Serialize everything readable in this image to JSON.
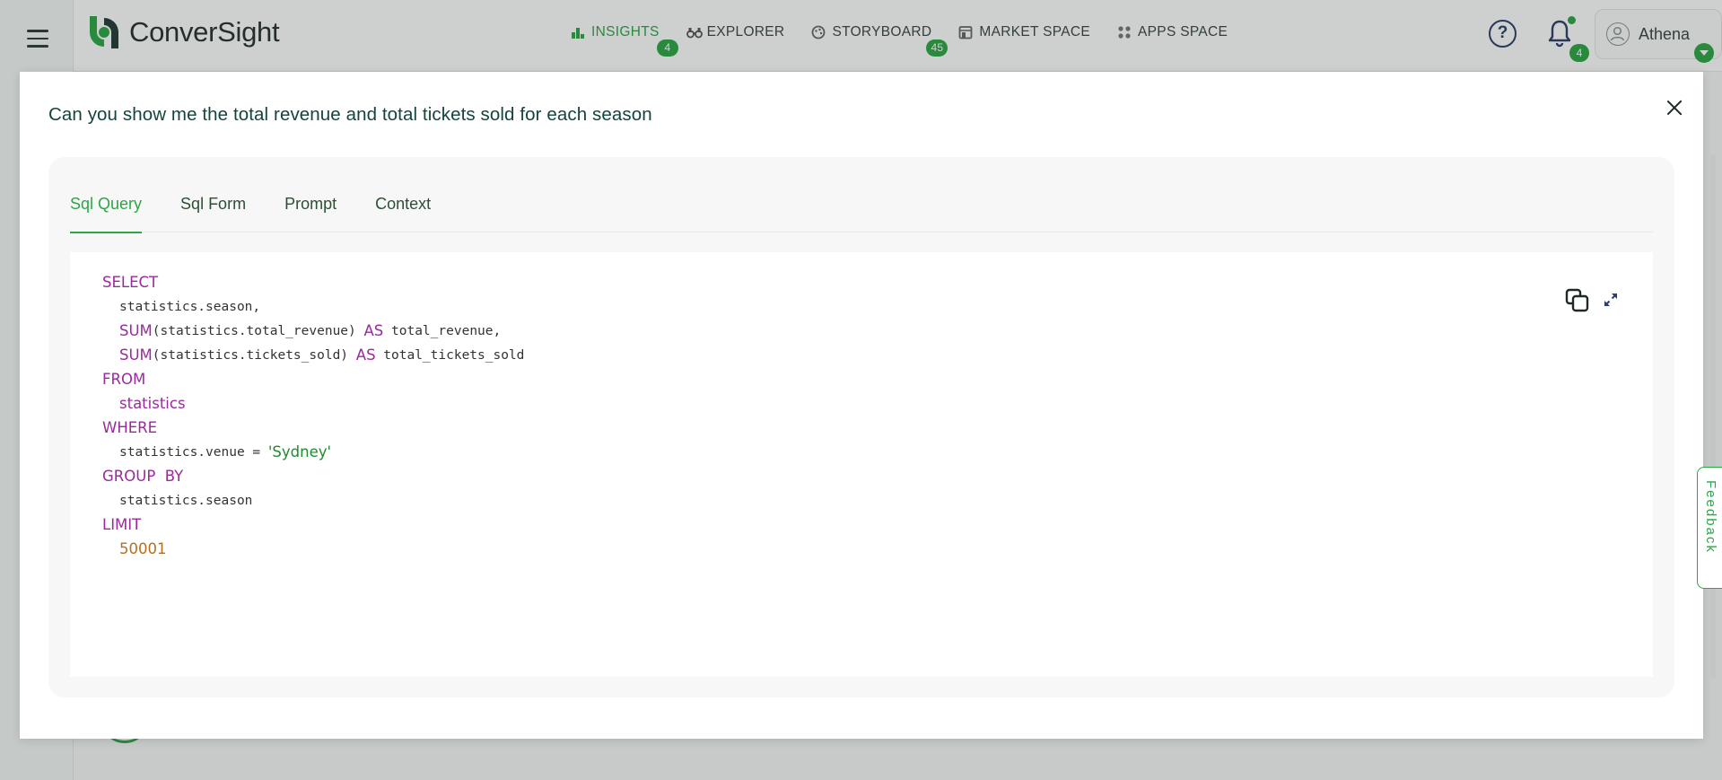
{
  "app": {
    "brand": "ConverSight",
    "nav": [
      {
        "label": "INSIGHTS",
        "badge": "4",
        "active": true,
        "icon": "bar-chart-icon"
      },
      {
        "label": "EXPLORER",
        "badge": "",
        "active": false,
        "icon": "binoculars-icon"
      },
      {
        "label": "STORYBOARD",
        "badge": "45",
        "active": false,
        "icon": "palette-icon"
      },
      {
        "label": "MARKET SPACE",
        "badge": "",
        "active": false,
        "icon": "store-icon"
      },
      {
        "label": "APPS SPACE",
        "badge": "",
        "active": false,
        "icon": "grid-icon"
      }
    ],
    "help_symbol": "?",
    "notifications_count": "4",
    "user_name": "Athena"
  },
  "modal": {
    "title": "Can you show me the total revenue and total tickets sold for each season",
    "tabs": [
      {
        "label": "Sql Query",
        "active": true
      },
      {
        "label": "Sql Form",
        "active": false
      },
      {
        "label": "Prompt",
        "active": false
      },
      {
        "label": "Context",
        "active": false
      }
    ],
    "sql": {
      "select_kw": "SELECT",
      "col1": "statistics.season,",
      "sum_kw": "SUM",
      "col2_arg": "(statistics.total_revenue)",
      "as_kw": "AS",
      "col2_alias": "total_revenue,",
      "col3_arg": "(statistics.tickets_sold)",
      "col3_alias": "total_tickets_sold",
      "from_kw": "FROM",
      "table": "statistics",
      "where_kw": "WHERE",
      "where_lhs": "statistics.venue = ",
      "where_value": "'Sydney'",
      "group_kw": "GROUP  BY",
      "group_col": "statistics.season",
      "limit_kw": "LIMIT",
      "limit_value": "50001"
    }
  },
  "feedback_label": "Feedback",
  "colors": {
    "accent": "#2ca646",
    "keyword": "#9a2a9c",
    "string": "#1f8a2e",
    "number": "#b5701b",
    "title": "#13443d"
  }
}
